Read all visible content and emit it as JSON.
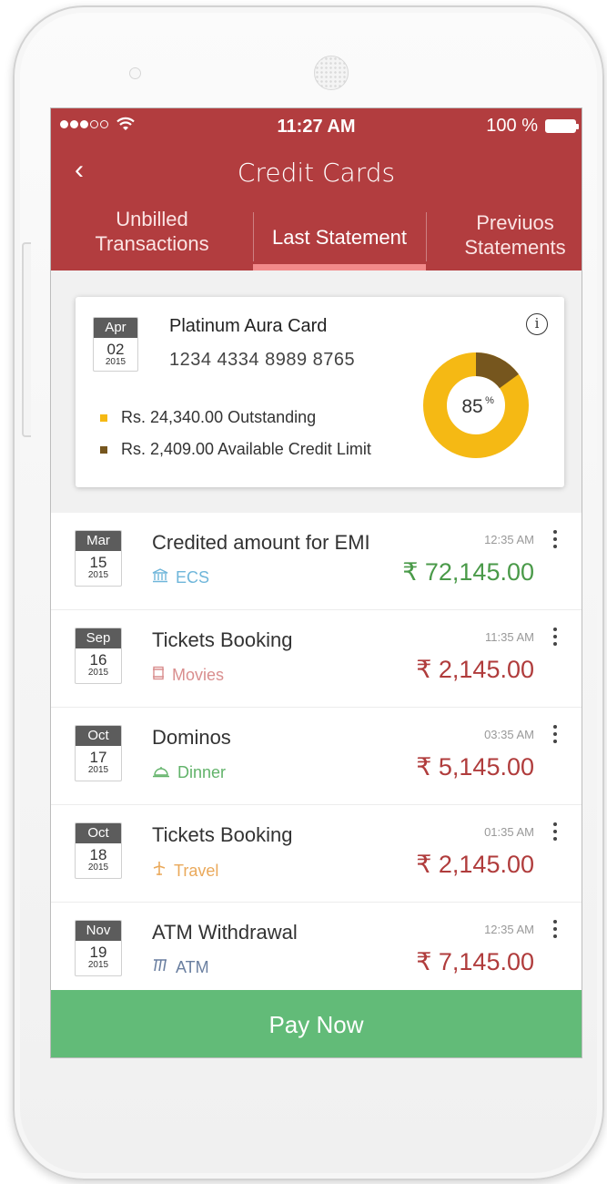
{
  "status": {
    "time": "11:27 AM",
    "battery": "100 %"
  },
  "header": {
    "title": "Credit Cards",
    "back_icon": "‹"
  },
  "tabs": [
    {
      "line1": "Unbilled",
      "line2": "Transactions"
    },
    {
      "line1": "Last Statement",
      "line2": ""
    },
    {
      "line1": "Previuos",
      "line2": "Statements"
    }
  ],
  "card": {
    "date": {
      "month": "Apr",
      "day": "02",
      "year": "2015"
    },
    "name": "Platinum Aura Card",
    "number": "1234 4334 8989 8765",
    "info_icon": "i",
    "outstanding": "Rs. 24,340.00 Outstanding",
    "available": "Rs. 2,409.00 Available Credit Limit",
    "usage_percent": 85,
    "usage_label": "85",
    "usage_suffix": "%",
    "colors": {
      "used": "#f5b914",
      "available": "#76561e"
    }
  },
  "transactions": [
    {
      "month": "Mar",
      "day": "15",
      "year": "2015",
      "title": "Credited amount for EMI",
      "category": "ECS",
      "category_icon": "bank-icon",
      "time": "12:35 AM",
      "amount": "₹ 72,145.00",
      "amount_color": "#4a9a49",
      "category_color": "#6fb6da"
    },
    {
      "month": "Sep",
      "day": "16",
      "year": "2015",
      "title": "Tickets Booking",
      "category": "Movies",
      "category_icon": "film-icon",
      "time": "11:35 AM",
      "amount": "₹ 2,145.00",
      "amount_color": "#b03c3c",
      "category_color": "#d98e8e"
    },
    {
      "month": "Oct",
      "day": "17",
      "year": "2015",
      "title": "Dominos",
      "category": "Dinner",
      "category_icon": "cloche-icon",
      "time": "03:35 AM",
      "amount": "₹ 5,145.00",
      "amount_color": "#b03c3c",
      "category_color": "#62b36a"
    },
    {
      "month": "Oct",
      "day": "18",
      "year": "2015",
      "title": "Tickets Booking",
      "category": "Travel",
      "category_icon": "plane-icon",
      "time": "01:35 AM",
      "amount": "₹ 2,145.00",
      "amount_color": "#b03c3c",
      "category_color": "#eaa95b"
    },
    {
      "month": "Nov",
      "day": "19",
      "year": "2015",
      "title": "ATM Withdrawal",
      "category": "ATM",
      "category_icon": "atm-icon",
      "time": "12:35 AM",
      "amount": "₹ 7,145.00",
      "amount_color": "#b03c3c",
      "category_color": "#6a7fa0"
    }
  ],
  "pay_button": "Pay Now"
}
